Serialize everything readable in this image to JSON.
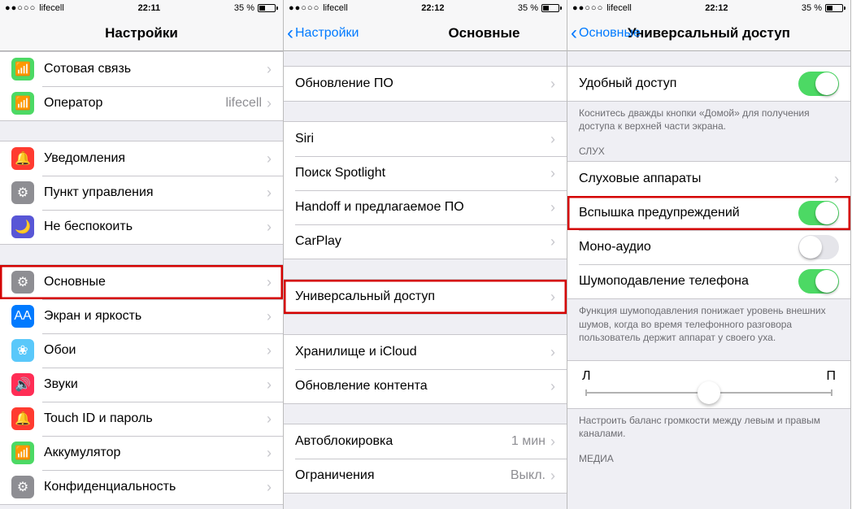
{
  "status": {
    "carrier": "lifecell",
    "time1": "22:11",
    "time2": "22:12",
    "time3": "22:12",
    "battery": "35 %"
  },
  "s1": {
    "title": "Настройки",
    "items_a": [
      {
        "label": "Сотовая связь",
        "icon": "bg-green"
      },
      {
        "label": "Оператор",
        "icon": "bg-green",
        "detail": "lifecell"
      }
    ],
    "items_b": [
      {
        "label": "Уведомления",
        "icon": "bg-red"
      },
      {
        "label": "Пункт управления",
        "icon": "bg-gray"
      },
      {
        "label": "Не беспокоить",
        "icon": "bg-purple"
      }
    ],
    "items_c": [
      {
        "label": "Основные",
        "icon": "bg-gray",
        "hl": true
      },
      {
        "label": "Экран и яркость",
        "icon": "bg-blue"
      },
      {
        "label": "Обои",
        "icon": "bg-lightblue"
      },
      {
        "label": "Звуки",
        "icon": "bg-pink"
      },
      {
        "label": "Touch ID и пароль",
        "icon": "bg-red"
      },
      {
        "label": "Аккумулятор",
        "icon": "bg-green"
      },
      {
        "label": "Конфиденциальность",
        "icon": "bg-gray"
      }
    ]
  },
  "s2": {
    "back": "Настройки",
    "title": "Основные",
    "g1": [
      "Обновление ПО"
    ],
    "g2": [
      "Siri",
      "Поиск Spotlight",
      "Handoff и предлагаемое ПО",
      "CarPlay"
    ],
    "g3": [
      "Универсальный доступ"
    ],
    "g4": [
      "Хранилище и iCloud",
      "Обновление контента"
    ],
    "g5": [
      {
        "label": "Автоблокировка",
        "detail": "1 мин"
      },
      {
        "label": "Ограничения",
        "detail": "Выкл."
      }
    ]
  },
  "s3": {
    "back": "Основные",
    "title": "Универсальный доступ",
    "reach": {
      "label": "Удобный доступ",
      "note": "Коснитесь дважды кнопки «Домой» для получения доступа к верхней части экрана."
    },
    "hearing_header": "СЛУХ",
    "hearing": [
      {
        "label": "Слуховые аппараты",
        "type": "chevron"
      },
      {
        "label": "Вспышка предупреждений",
        "type": "toggle",
        "on": true,
        "hl": true
      },
      {
        "label": "Моно-аудио",
        "type": "toggle",
        "on": false
      },
      {
        "label": "Шумоподавление телефона",
        "type": "toggle",
        "on": true
      }
    ],
    "noise_note": "Функция шумоподавления понижает уровень внешних шумов, когда во время телефонного разговора пользователь держит аппарат у своего уха.",
    "balance": {
      "left": "Л",
      "right": "П",
      "note": "Настроить баланс громкости между левым и правым каналами."
    },
    "media_header": "МЕДИА"
  }
}
